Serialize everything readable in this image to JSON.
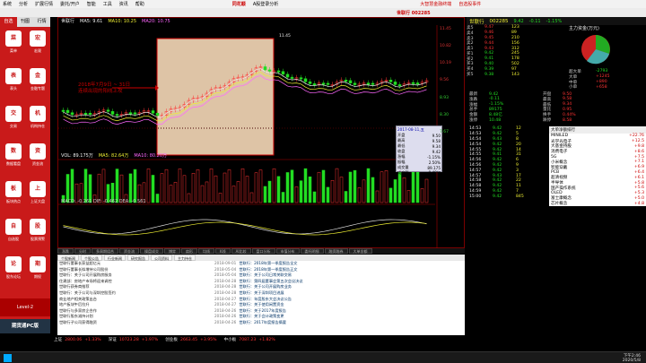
{
  "window": {
    "title": "大智慧金融终端",
    "stock_title": "世联行 002285"
  },
  "menu": [
    "系统",
    "分析",
    "扩展行情",
    "委托/开户",
    "智能",
    "工具",
    "资讯",
    "帮助"
  ],
  "brand": "同花顺",
  "menu_right": "A股登录分析",
  "menu_acc": "大智慧金融终端",
  "menu_acc2": "自选股事件",
  "left_tabs": [
    "自选",
    "刊图",
    "行情"
  ],
  "left_items": [
    {
      "icon": "菜",
      "label": "菜单"
    },
    {
      "icon": "宏",
      "label": "宏观"
    },
    {
      "icon": "表",
      "label": "表头"
    },
    {
      "icon": "金",
      "label": "金融专题"
    },
    {
      "icon": "交",
      "label": "交易"
    },
    {
      "icon": "机",
      "label": "机构持仓"
    },
    {
      "icon": "数",
      "label": "数据看盘"
    },
    {
      "icon": "资",
      "label": "资金流"
    },
    {
      "icon": "板",
      "label": "板块热点"
    },
    {
      "icon": "上",
      "label": "上证大盘"
    },
    {
      "icon": "自",
      "label": "自选股"
    },
    {
      "icon": "股",
      "label": "股票预警"
    },
    {
      "icon": "论",
      "label": "股东论坛"
    },
    {
      "icon": "期",
      "label": "期权"
    }
  ],
  "left_bottom": {
    "label1": "420分钟",
    "label2": "Level-2",
    "label3": "期货通PC版"
  },
  "chart_info": {
    "name": "世联行",
    "ma5": "MA5: 9.61",
    "ma10": "MA10: 10.25",
    "ma20": "MA20: 10.75",
    "high": "11.45",
    "low": "8.83",
    "note1": "2018年7月9日 ~ 31日",
    "note2": "连续出现的阳线上攻",
    "vol_label": "VOL: 89.175万",
    "vol_ma5": "MA5: 82.64万",
    "vol_ma10": "MA10: 80.20万",
    "macd": "MACD: -0.261  DIF: -0.462  DEA: -0.561"
  },
  "tooltip": {
    "date": "2017-08-11,五",
    "open": "9.50",
    "high": "9.58",
    "low": "9.34",
    "close": "9.42",
    "pct": "-1.15%",
    "amp": "2.50%",
    "vol": "89.175",
    "amt": "8.48亿"
  },
  "y_ticks": [
    "11.45",
    "10.82",
    "10.19",
    "9.56",
    "8.93",
    "8.30",
    "7.67"
  ],
  "lower_tabs": [
    "涨跌",
    "分时",
    "多周期组合",
    "资金流",
    "操盘成交",
    "博弈",
    "扇形",
    "均线",
    "K线",
    "AI比较",
    "盘口分析",
    "市值分布",
    "委托明细",
    "融资融券",
    "大单金额"
  ],
  "news_tabs": [
    "个股新闻",
    "个股公告",
    "行业新闻",
    "研究报告",
    "公司资料",
    "主力持仓"
  ],
  "news": [
    {
      "t": "世联行董事长获益超亿元",
      "d": "2018-09-01",
      "r": "世联行：2018年第一季度报告全文"
    },
    {
      "t": "世联行董事长拟增持公司股份",
      "d": "2018-05-04",
      "r": "世联行：2018年第一季度报告正文"
    },
    {
      "t": "世联行：关于公司开展购房服务",
      "d": "2018-05-04",
      "r": "世联行：关于公司日常关联交易"
    },
    {
      "t": "住建部：房地产市场将迎来调控",
      "d": "2018-04-28",
      "r": "世联行：第四届董事会第五次会议决议"
    },
    {
      "t": "世联行获券商推荐",
      "d": "2018-04-28",
      "r": "世联行：关于公司开展购房业务"
    },
    {
      "t": "世联行：关于公司与深圳控股签约",
      "d": "2018-04-28",
      "r": "世联行：关于深圳项目进展"
    },
    {
      "t": "商业地产相关政策出台",
      "d": "2018-04-27",
      "r": "世联行：年度股东大会决议公告"
    },
    {
      "t": "地产板块午后拉升",
      "d": "2018-04-27",
      "r": "世联行：关于使用闲置资金"
    },
    {
      "t": "世联行与多家房企合作",
      "d": "2018-04-26",
      "r": "世联行：关于2017年度报告"
    },
    {
      "t": "世联行股东减持计划",
      "d": "2018-04-26",
      "r": "世联行：关于会计政策变更"
    },
    {
      "t": "世联行子公司获得融资",
      "d": "2018-04-26",
      "r": "世联行：2017年度报告摘要"
    }
  ],
  "quote": {
    "code": "002285",
    "name": "世联行",
    "price": "9.42",
    "chg": "-0.11",
    "pct": "-1.15%",
    "sells": [
      [
        "卖5",
        "9.47",
        "123"
      ],
      [
        "卖4",
        "9.46",
        "89"
      ],
      [
        "卖3",
        "9.45",
        "210"
      ],
      [
        "卖2",
        "9.44",
        "156"
      ],
      [
        "卖1",
        "9.43",
        "312"
      ]
    ],
    "buys": [
      [
        "买1",
        "9.42",
        "245"
      ],
      [
        "买2",
        "9.41",
        "178"
      ],
      [
        "买3",
        "9.40",
        "502"
      ],
      [
        "买4",
        "9.39",
        "97"
      ],
      [
        "买5",
        "9.38",
        "143"
      ]
    ],
    "stats": [
      [
        "最新",
        "9.42",
        "开盘",
        "9.50"
      ],
      [
        "涨跌",
        "-0.11",
        "最高",
        "9.58"
      ],
      [
        "涨幅",
        "-1.15%",
        "最低",
        "9.34"
      ],
      [
        "总手",
        "89175",
        "量比",
        "0.95"
      ],
      [
        "金额",
        "8.48亿",
        "换手",
        "0.44%"
      ],
      [
        "涨停",
        "10.48",
        "跌停",
        "8.58"
      ]
    ]
  },
  "fund": {
    "title": "主力资金(万元)",
    "items": [
      [
        "超大单",
        "-2793"
      ],
      [
        "大单",
        "+1245"
      ],
      [
        "中单",
        "+890"
      ],
      [
        "小单",
        "+658"
      ]
    ],
    "pct": "53%"
  },
  "ticks": [
    [
      "14:53",
      "9.42",
      "12"
    ],
    [
      "14:53",
      "9.42",
      "5"
    ],
    [
      "14:54",
      "9.43",
      "8"
    ],
    [
      "14:54",
      "9.42",
      "20"
    ],
    [
      "14:55",
      "9.42",
      "14"
    ],
    [
      "14:55",
      "9.41",
      "31"
    ],
    [
      "14:56",
      "9.42",
      "6"
    ],
    [
      "14:56",
      "9.42",
      "9"
    ],
    [
      "14:57",
      "9.42",
      "3"
    ],
    [
      "14:57",
      "9.43",
      "17"
    ],
    [
      "14:58",
      "9.42",
      "22"
    ],
    [
      "14:58",
      "9.42",
      "11"
    ],
    [
      "14:59",
      "9.42",
      "7"
    ],
    [
      "15:00",
      "9.42",
      "845"
    ]
  ],
  "sectors": [
    [
      "MINILED",
      "+22.76"
    ],
    [
      "光学光电子",
      "+12.5"
    ],
    [
      "大基金持股",
      "+9.8"
    ],
    [
      "消费电子",
      "+8.6"
    ],
    [
      "5G",
      "+7.5"
    ],
    [
      "小米概念",
      "+7.1"
    ],
    [
      "智能穿戴",
      "+6.9"
    ],
    [
      "PCB",
      "+6.4"
    ],
    [
      "超清视频",
      "+6.1"
    ],
    [
      "半导体",
      "+5.8"
    ],
    [
      "国产操作系统",
      "+5.6"
    ],
    [
      "OLED",
      "+5.3"
    ],
    [
      "富士康概念",
      "+5.0"
    ],
    [
      "芯片概念",
      "+4.8"
    ]
  ],
  "sector_title": "大单净额排行",
  "ticker": [
    [
      "上证",
      "2800.06",
      "+1.33%"
    ],
    [
      "深证",
      "10723.28",
      "+1.97%"
    ],
    [
      "创业板",
      "2663.45",
      "+3.95%"
    ],
    [
      "中小板",
      "7087.23",
      "+1.82%"
    ]
  ],
  "taskbar": {
    "time": "下午2:46",
    "date": "2020/5/8"
  },
  "colors": {
    "up": "#ff3333",
    "down": "#22dd22",
    "accent": "#c91a1a"
  }
}
